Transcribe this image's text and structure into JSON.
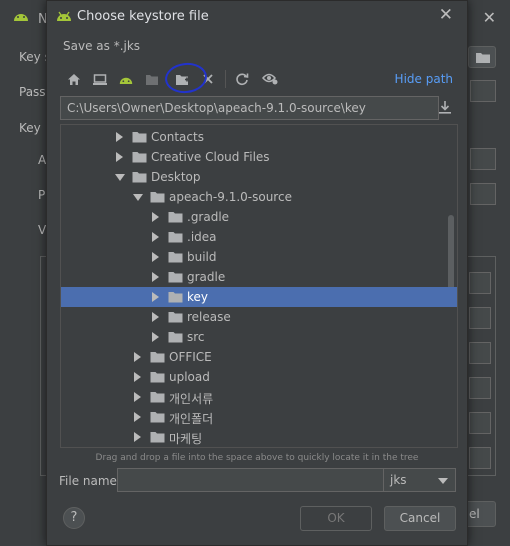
{
  "background_dialog": {
    "title": "N",
    "labels": [
      "Key s",
      "Passw",
      "Key",
      "A",
      "P",
      "V"
    ],
    "bottom_button": "el"
  },
  "dialog": {
    "title": "Choose keystore file",
    "subtitle": "Save as *.jks",
    "hide_path_label": "Hide path",
    "path": "C:\\Users\\Owner\\Desktop\\apeach-9.1.0-source\\key",
    "toolbar_icons": [
      "home-icon",
      "desktop-icon",
      "android-icon",
      "module-icon",
      "new-folder-icon",
      "delete-icon",
      "refresh-icon",
      "show-hidden-icon"
    ]
  },
  "tree": {
    "items": [
      {
        "label": "Contacts",
        "depth": 0,
        "expanded": false,
        "selected": false
      },
      {
        "label": "Creative Cloud Files",
        "depth": 0,
        "expanded": false,
        "selected": false
      },
      {
        "label": "Desktop",
        "depth": 0,
        "expanded": true,
        "selected": false
      },
      {
        "label": "apeach-9.1.0-source",
        "depth": 1,
        "expanded": true,
        "selected": false
      },
      {
        "label": ".gradle",
        "depth": 2,
        "expanded": false,
        "selected": false
      },
      {
        "label": ".idea",
        "depth": 2,
        "expanded": false,
        "selected": false
      },
      {
        "label": "build",
        "depth": 2,
        "expanded": false,
        "selected": false
      },
      {
        "label": "gradle",
        "depth": 2,
        "expanded": false,
        "selected": false
      },
      {
        "label": "key",
        "depth": 2,
        "expanded": false,
        "selected": true
      },
      {
        "label": "release",
        "depth": 2,
        "expanded": false,
        "selected": false
      },
      {
        "label": "src",
        "depth": 2,
        "expanded": false,
        "selected": false
      },
      {
        "label": "OFFICE",
        "depth": 1,
        "expanded": false,
        "selected": false
      },
      {
        "label": "upload",
        "depth": 1,
        "expanded": false,
        "selected": false
      },
      {
        "label": "개인서류",
        "depth": 1,
        "expanded": false,
        "selected": false
      },
      {
        "label": "개인폴더",
        "depth": 1,
        "expanded": false,
        "selected": false
      },
      {
        "label": "마케팅",
        "depth": 1,
        "expanded": false,
        "selected": false
      }
    ]
  },
  "hint": "Drag and drop a file into the space above to quickly locate it in the tree",
  "file_name": {
    "label": "File name:",
    "value": "",
    "extension": "jks"
  },
  "buttons": {
    "help": "?",
    "ok": "OK",
    "cancel": "Cancel"
  },
  "colors": {
    "accent": "#589df6",
    "selection": "#4b6eaf",
    "android_green": "#a4c639",
    "annotation_circle": "#2233cc"
  }
}
